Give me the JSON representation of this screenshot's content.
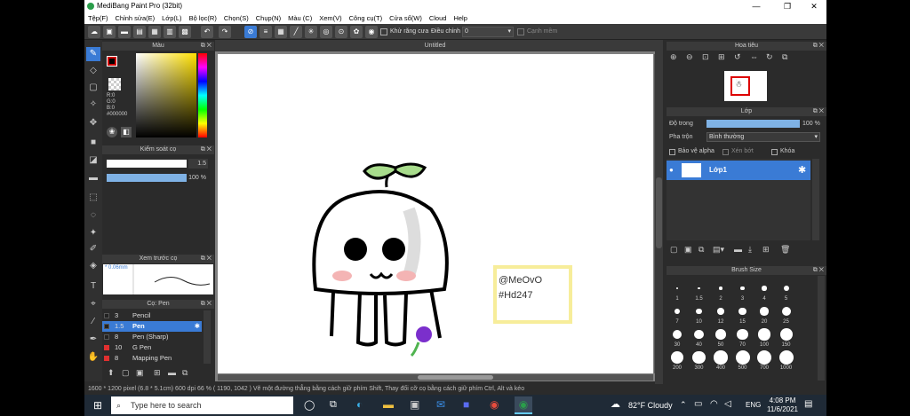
{
  "window": {
    "title": "MediBang Paint Pro (32bit)"
  },
  "menu": [
    "Tệp(F)",
    "Chỉnh sửa(E)",
    "Lớp(L)",
    "Bộ lọc(R)",
    "Chọn(S)",
    "Chụp(N)",
    "Màu (C)",
    "Xem(V)",
    "Công cụ(T)",
    "Cửa sổ(W)",
    "Cloud",
    "Help"
  ],
  "toolbar": {
    "antialias_label": "Khử răng cưa",
    "adjust_label": "Điều chỉnh",
    "adjust_value": "0",
    "edge_label": "Cạnh mềm"
  },
  "color_panel": {
    "title": "Màu",
    "r": "R:0",
    "g": "G:0",
    "b": "B:0",
    "hex": "#000000"
  },
  "brush_control": {
    "title": "Kiểm soát cọ",
    "size": "1.5",
    "opacity": "100 %"
  },
  "brush_preview": {
    "title": "Xem trước cọ",
    "size_label": "* 0.06mm"
  },
  "brush_list": {
    "title": "Cọ: Pen",
    "items": [
      {
        "size": "3",
        "name": "Pencil"
      },
      {
        "size": "1.5",
        "name": "Pen",
        "selected": true
      },
      {
        "size": "8",
        "name": "Pen (Sharp)"
      },
      {
        "size": "10",
        "name": "G Pen"
      },
      {
        "size": "8",
        "name": "Mapping Pen"
      }
    ]
  },
  "canvas": {
    "tab": "Untitled",
    "signature": [
      "@MeOvO",
      "#Hd247"
    ]
  },
  "navigator": {
    "title": "Hoa tiêu"
  },
  "layer_panel": {
    "title": "Lớp",
    "opacity_label": "Độ trong",
    "opacity_value": "100 %",
    "blend_label": "Pha trộn",
    "blend_value": "Bình thường",
    "protect_alpha": "Bảo vệ alpha",
    "clip": "Xén bớt",
    "lock": "Khóa",
    "layer_name": "Lớp1"
  },
  "brush_size_panel": {
    "title": "Brush Size",
    "sizes": [
      "1",
      "1.5",
      "2",
      "3",
      "4",
      "5",
      "7",
      "10",
      "12",
      "15",
      "20",
      "25",
      "30",
      "40",
      "50",
      "70",
      "100",
      "150",
      "200",
      "300",
      "400",
      "500",
      "700",
      "1000"
    ]
  },
  "status": {
    "text": "1600 * 1200 pixel  (6.8 * 5.1cm)  600 dpi  66 %  ( 1190, 1042 )  Vẽ một đường thẳng bằng cách giữ phím Shift, Thay đổi cỡ cọ bằng cách giữ phím Ctrl, Alt và kéo"
  },
  "taskbar": {
    "search": "Type here to search",
    "weather": "82°F  Cloudy",
    "lang": "ENG",
    "time": "4:08 PM",
    "date": "11/6/2021"
  }
}
